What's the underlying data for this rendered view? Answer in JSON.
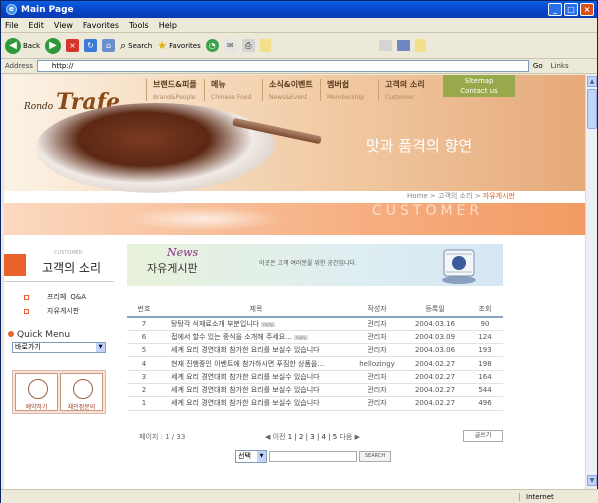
{
  "window": {
    "title": "Main Page",
    "ie_glyph": "e",
    "min": "_",
    "max": "□",
    "close": "×"
  },
  "menubar": [
    "File",
    "Edit",
    "View",
    "Favorites",
    "Tools",
    "Help"
  ],
  "toolbar": {
    "back": "Back",
    "search": "Search",
    "favorites": "Favorites"
  },
  "address": {
    "label": "Address",
    "value": "http://",
    "go": "Go",
    "links": "Links"
  },
  "status": {
    "left": "",
    "zone": "Internet"
  },
  "site": {
    "logo": {
      "pre": "Rondo",
      "main": "Trafe",
      "post": "…"
    },
    "gnb": [
      {
        "ko": "브랜드&피플",
        "en": "Brand&People"
      },
      {
        "ko": "메뉴",
        "en": "Chinese Food"
      },
      {
        "ko": "소식&이벤트",
        "en": "News&Event"
      },
      {
        "ko": "멤버쉽",
        "en": "Membership"
      },
      {
        "ko": "고객의 소리",
        "en": "Customer"
      }
    ],
    "sitemap": "Sitemap",
    "contact": "Contact us",
    "slogan": "맛과 품격의 향연",
    "breadcrumb": {
      "home": "Home",
      "mid": "고객의 소리",
      "current": "자유게시판",
      "sep": ">"
    },
    "band_text": "CUSTOMER"
  },
  "left": {
    "en": "CUSTOMER",
    "title": "고객의 소리",
    "menu": [
      {
        "a": "프리페",
        "b": "Q&A"
      },
      {
        "a": "",
        "b": "자유게시판"
      }
    ],
    "quick": "Quick Menu",
    "select": "바로가기",
    "select_arrow": "▼",
    "banners": [
      "예약하기",
      "체인점문의"
    ]
  },
  "board": {
    "news": "News",
    "title": "자유게시판",
    "desc": "이곳은 고객 여러분을 위한 공간입니다.",
    "columns": [
      "번호",
      "제목",
      "작성자",
      "등록일",
      "조회"
    ],
    "reply_badge": "reply",
    "rows": [
      {
        "no": "7",
        "title": "탕탕각 식재료소개 부분입니다",
        "reply": true,
        "author": "관리자",
        "date": "2004.03.16",
        "views": "90"
      },
      {
        "no": "6",
        "title": "접에서 할수 있는 중식을 소개해 주세요...",
        "reply": true,
        "author": "관리자",
        "date": "2004.03.09",
        "views": "124"
      },
      {
        "no": "5",
        "title": "세계 요리 경연대회 참가한 요리를 보실수 있습니다",
        "reply": false,
        "author": "관리자",
        "date": "2004.03.06",
        "views": "193"
      },
      {
        "no": "4",
        "title": "현재 진행중인 이벤트에 참가하시면 푸짐한 상품을...",
        "reply": false,
        "author": "hellozingy",
        "date": "2004.02.27",
        "views": "198"
      },
      {
        "no": "3",
        "title": "세계 요리 경연대회 참가한 요리를 보실수 있습니다",
        "reply": false,
        "author": "관리자",
        "date": "2004.02.27",
        "views": "164"
      },
      {
        "no": "2",
        "title": "세계 요리 경연대회 참가한 요리를 보실수 있습니다",
        "reply": false,
        "author": "관리자",
        "date": "2004.02.27",
        "views": "544"
      },
      {
        "no": "1",
        "title": "세계 요리 경연대회 참가한 요리를 보실수 있습니다",
        "reply": false,
        "author": "관리자",
        "date": "2004.02.27",
        "views": "496"
      }
    ],
    "page_label": "페이지 : 1 / 33",
    "prev": "◀ 이전",
    "pages": "1 | 2 | 3 | 4 | 5",
    "next": "다음 ▶",
    "write": "글쓰기",
    "search": {
      "select": "선택",
      "select_arrow": "▼",
      "button": "SEARCH"
    }
  }
}
